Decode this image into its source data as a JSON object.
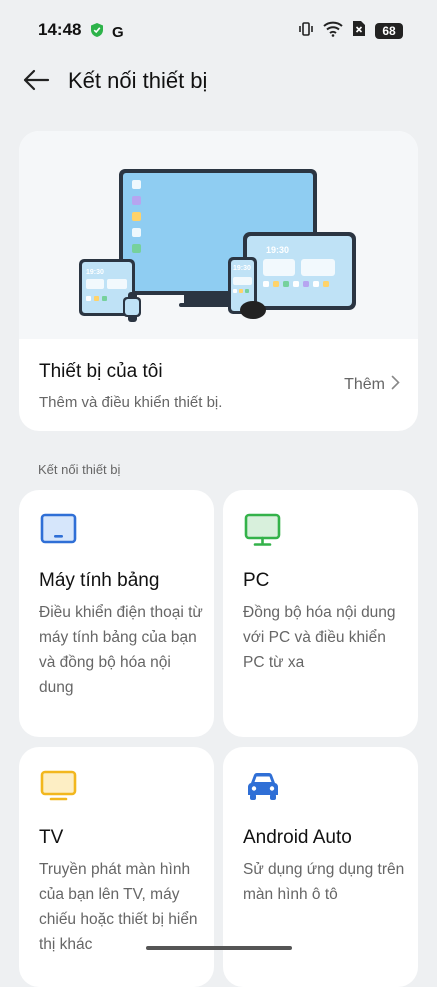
{
  "status_bar": {
    "time": "14:48",
    "g_label": "G",
    "battery": "68"
  },
  "header": {
    "title": "Kết nối thiết bị"
  },
  "illustration": {
    "tablet_time": "19:30",
    "phone_time": "19:30",
    "small_tablet_time": "19:30"
  },
  "my_devices": {
    "title": "Thiết bị của tôi",
    "subtitle": "Thêm và điều khiển thiết bị.",
    "add_label": "Thêm"
  },
  "section": {
    "label": "Kết nối thiết bị"
  },
  "tiles": [
    {
      "title": "Máy tính bảng",
      "desc": "Điều khiển điện thoại từ máy tính bảng của bạn và đồng bộ hóa nội dung",
      "icon": "tablet-icon",
      "color": "#2f6fd6"
    },
    {
      "title": "PC",
      "desc": "Đồng bộ hóa nội dung với PC và điều khiển PC từ xa",
      "icon": "monitor-icon",
      "color": "#34b24a"
    },
    {
      "title": "TV",
      "desc": "Truyền phát màn hình của bạn lên TV, máy chiếu hoặc thiết bị hiển thị khác",
      "icon": "tv-icon",
      "color": "#f2b71e"
    },
    {
      "title": "Android Auto",
      "desc": "Sử dụng ứng dụng trên màn hình ô tô",
      "icon": "car-icon",
      "color": "#2f6fd6"
    }
  ]
}
